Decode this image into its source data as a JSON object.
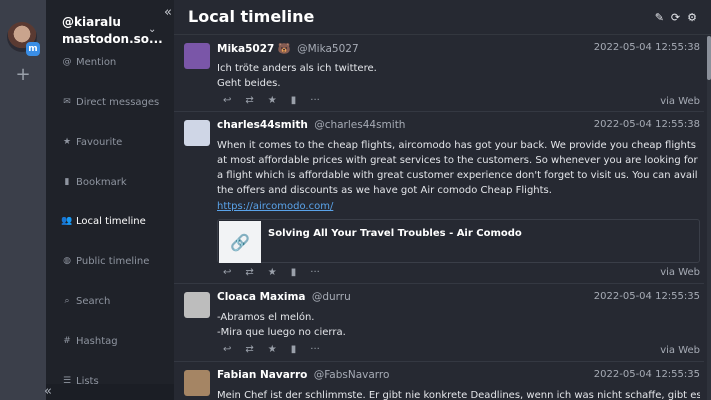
{
  "account": {
    "handle": "@kiaralu",
    "server": "mastodon.so..."
  },
  "nav": [
    {
      "label": "Mention",
      "icon": "at-icon",
      "glyph": "@"
    },
    {
      "label": "Direct messages",
      "icon": "envelope-icon",
      "glyph": "✉"
    },
    {
      "label": "Favourite",
      "icon": "star-icon",
      "glyph": "★"
    },
    {
      "label": "Bookmark",
      "icon": "bookmark-icon",
      "glyph": "▮"
    },
    {
      "label": "Local timeline",
      "icon": "users-icon",
      "glyph": "👥",
      "active": true
    },
    {
      "label": "Public timeline",
      "icon": "globe-icon",
      "glyph": "◍"
    },
    {
      "label": "Search",
      "icon": "search-icon",
      "glyph": "⌕"
    },
    {
      "label": "Hashtag",
      "icon": "hashtag-icon",
      "glyph": "#"
    },
    {
      "label": "Lists",
      "icon": "list-icon",
      "glyph": "☰"
    }
  ],
  "header": {
    "title": "Local timeline"
  },
  "statuses": [
    {
      "display_name": "Mika5027",
      "emoji": "🐻",
      "acct": "@Mika5027",
      "time": "2022-05-04 12:55:38",
      "content": [
        "Ich tröte anders als ich twittere.",
        "Geht beides."
      ],
      "via": "via Web",
      "avatar_color": "#7a56a8"
    },
    {
      "display_name": "charles44smith",
      "acct": "@charles44smith",
      "time": "2022-05-04 12:55:38",
      "content": [
        "When it comes to the cheap flights, aircomodo has got your back. We provide you cheap flights at most affordable prices with great services to the customers. So whenever you are looking for a flight which is affordable with great customer experience don't forget to visit us. You can avail the offers and discounts as we have got Air comodo Cheap Flights."
      ],
      "link": "https://aircomodo.com/",
      "card_title": "Solving All Your Travel Troubles - Air Comodo",
      "via": "via Web",
      "avatar_color": "#cfd6e6"
    },
    {
      "display_name": "Cloaca Maxima",
      "acct": "@durru",
      "time": "2022-05-04 12:55:35",
      "content": [
        "-Abramos el melón.",
        "-Mira que luego no cierra."
      ],
      "via": "via Web",
      "avatar_color": "#bdbdbd"
    },
    {
      "display_name": "Fabian Navarro",
      "acct": "@FabsNavarro",
      "time": "2022-05-04 12:55:35",
      "content": [
        "Mein Chef ist der schlimmste. Er gibt nie konkrete Deadlines, wenn ich was nicht schaffe, gibt es statt"
      ],
      "avatar_color": "#a58564"
    }
  ]
}
